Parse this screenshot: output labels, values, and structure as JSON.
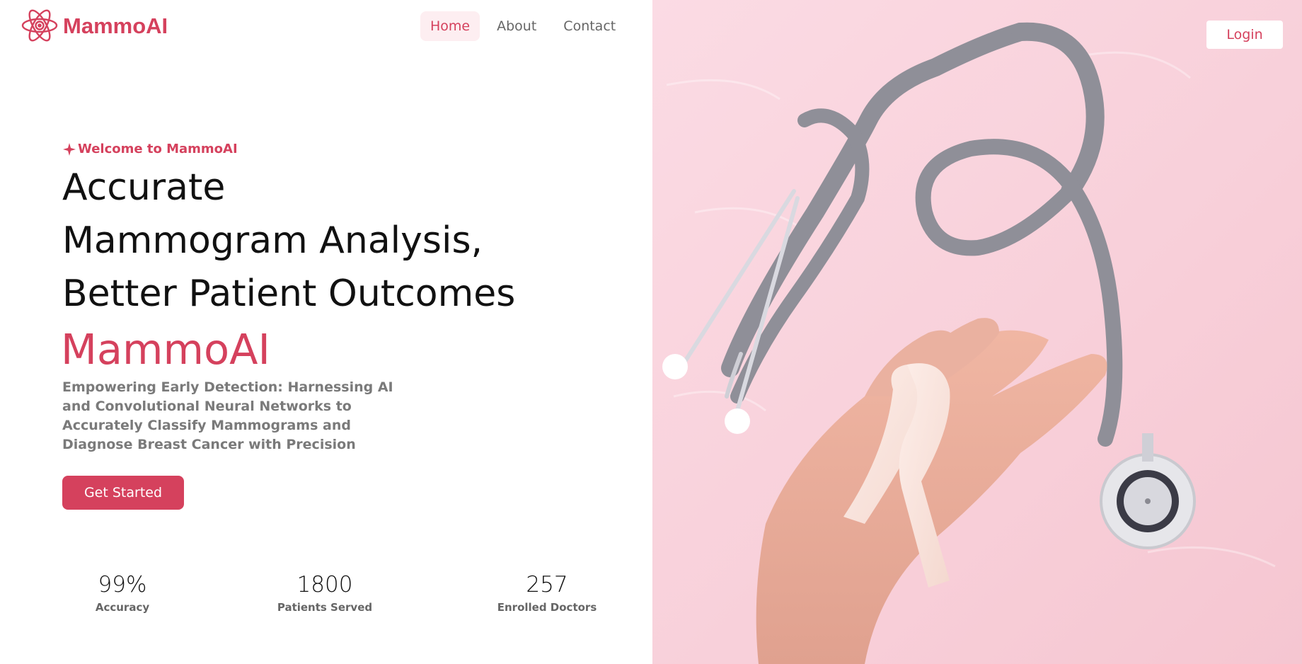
{
  "header": {
    "logo_text": "MammoAI",
    "logo_icon": "atom-icon",
    "nav": [
      {
        "label": "Home",
        "active": true
      },
      {
        "label": "About",
        "active": false
      },
      {
        "label": "Contact",
        "active": false
      }
    ],
    "login_label": "Login"
  },
  "hero": {
    "welcome_icon": "sparkle-icon",
    "welcome_text": "Welcome to MammoAI",
    "headline": [
      "Accurate",
      "Mammogram Analysis,",
      "Better Patient Outcomes"
    ],
    "brand": "MammoAI",
    "description": "Empowering Early Detection: Harnessing AI and Convolutional Neural Networks to Accurately Classify Mammograms and Diagnose Breast Cancer with Precision",
    "cta_label": "Get Started"
  },
  "stats": [
    {
      "value": "99%",
      "label": "Accuracy"
    },
    {
      "value": "1800",
      "label": "Patients Served"
    },
    {
      "value": "257",
      "label": "Enrolled Doctors"
    }
  ],
  "colors": {
    "brand": "#d5415d",
    "nav_active_bg": "#fdeef1",
    "photo_bg": "#f9d5de",
    "text_dark": "#111111",
    "text_muted": "#7a7a7a"
  }
}
